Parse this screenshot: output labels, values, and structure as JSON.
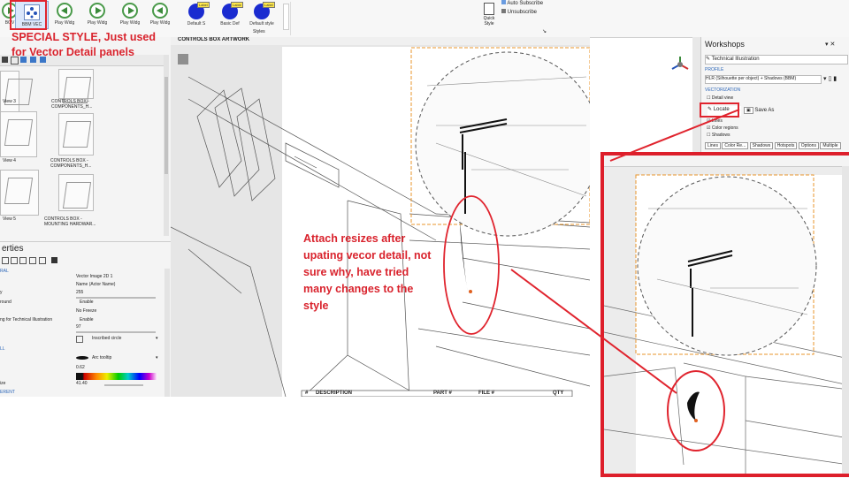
{
  "ribbon": {
    "buttons": [
      {
        "label": "BOV"
      },
      {
        "label": "BBM VEC"
      },
      {
        "label": "Play Widg"
      },
      {
        "label": "Play Widg"
      },
      {
        "label": "Play Widg"
      },
      {
        "label": "Play Widg"
      }
    ],
    "styles": [
      {
        "label": "Default S",
        "badge": "Label"
      },
      {
        "label": "Basic Def",
        "badge": "Lable"
      },
      {
        "label": "Default style",
        "badge": "Label"
      }
    ],
    "styles_group": "Styles",
    "quick_style": "Quick Style",
    "auto_subscribe": "Auto Subscribe",
    "unsubscribe": "Unsubscribe"
  },
  "left": {
    "views": [
      {
        "label": "View 3",
        "title": "CONTROLS BOX - COMPONENTS_H..."
      },
      {
        "label": "View 4",
        "title": "CONTROLS BOX - COMPONENTS_H..."
      },
      {
        "label": "View 5",
        "title": "CONTROLS BOX - MOUNTING HARDWAR..."
      }
    ],
    "properties_title": "erties",
    "section_general": "RAL",
    "header_value": "Vector Image 2D 1",
    "props": [
      {
        "label": "",
        "value": "Name (Actor Name)"
      },
      {
        "label": "y",
        "value": "255"
      },
      {
        "label": "round",
        "value": "Enable"
      },
      {
        "label": "",
        "value": "No Freeze"
      },
      {
        "label": "ng for Technical Illustration",
        "value": "Enable"
      },
      {
        "label": "",
        "value": "97"
      },
      {
        "label": "",
        "value": "Inscribed circle"
      }
    ],
    "section_callout": "LL",
    "callout_type": "Arc tooltip",
    "callout_num": "0.62",
    "size_label": "ize",
    "size_value": "41.40",
    "section_reference": "ERENT"
  },
  "canvas": {
    "tab_title": "CONTROLS BOX ARTWORK",
    "table_headers": [
      "#",
      "DESCRIPTION",
      "PART #",
      "FILE #",
      "QTY"
    ]
  },
  "workshops": {
    "title": "Workshops",
    "mode": "Technical Illustration",
    "profile_label": "PROFILE",
    "profile_value": "HLR (Silhouette per object) + Shadows (BBM)",
    "vectorization_label": "VECTORIZATION",
    "detail_view": "Detail view",
    "locate": "Locate",
    "save_as": "Save As",
    "checks": [
      {
        "label": "Lines",
        "checked": true
      },
      {
        "label": "Color regions",
        "checked": true
      },
      {
        "label": "Shadows",
        "checked": false
      }
    ],
    "tabs": [
      "Lines",
      "Color Re...",
      "Shadows",
      "Hotspots",
      "Options",
      "Multiple"
    ]
  },
  "annotations": {
    "special_style": "SPECIAL STYLE, Just used for Vector Detail panels",
    "attach": "Attach resizes after upating vecor detail, not sure why, have tried many changes to the style"
  },
  "colors": {
    "annotation_red": "#d9232d",
    "ribbon_blue": "#1a2bd0",
    "dashed_orange": "#e8952b"
  }
}
